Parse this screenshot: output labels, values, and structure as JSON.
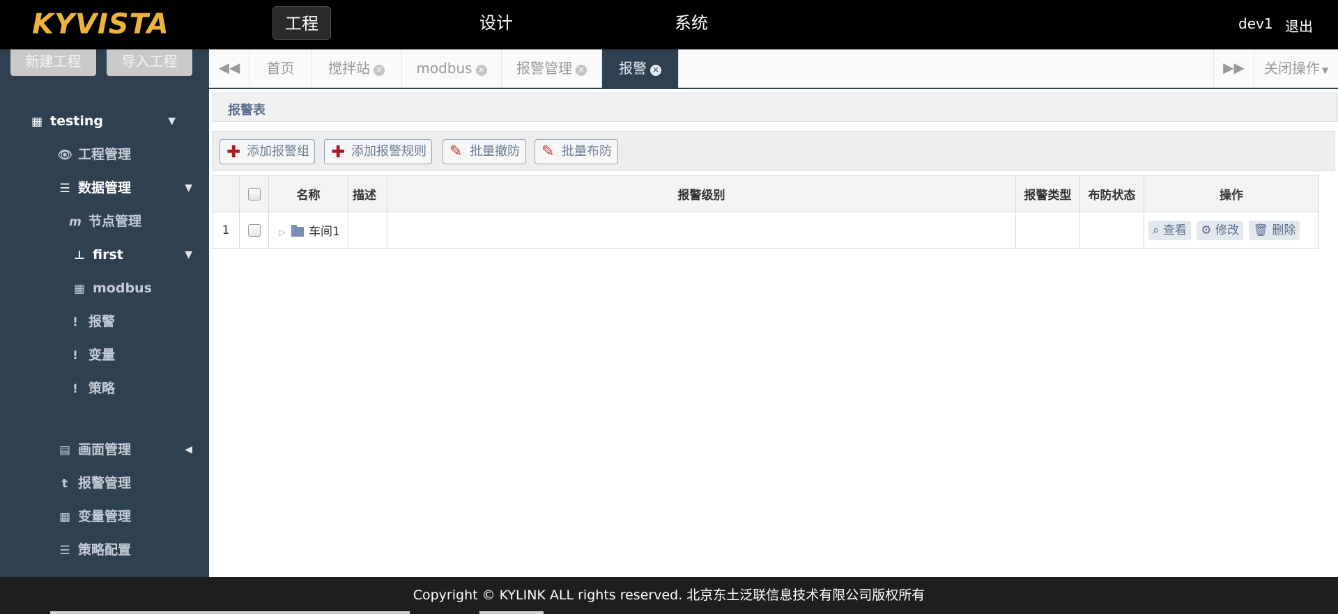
{
  "topbar": {
    "logo": "KYVISTA",
    "nav": {
      "project": "工程",
      "design": "设计",
      "system": "系统"
    },
    "user": "dev1",
    "logout": "退出"
  },
  "sidebar": {
    "buttons": {
      "new_project": "新建工程",
      "import_project": "导入工程"
    },
    "project_name": "testing",
    "items": {
      "project_mgmt": "工程管理",
      "data_mgmt": "数据管理",
      "node_mgmt": "节点管理",
      "first": "first",
      "modbus": "modbus",
      "alarm": "报警",
      "variable": "变量",
      "strategy": "策略",
      "screen_mgmt": "画面管理",
      "alarm_mgmt": "报警管理",
      "variable_mgmt": "变量管理",
      "strategy_config": "策略配置"
    }
  },
  "tabs": {
    "home": "首页",
    "mixer": "搅拌站",
    "modbus": "modbus",
    "alarm_mgmt": "报警管理",
    "alarm": "报警",
    "close_ops": "关闭操作"
  },
  "panel": {
    "title": "报警表",
    "toolbar": {
      "add_group": "添加报警组",
      "add_rule": "添加报警规则",
      "batch_disarm": "批量撤防",
      "batch_arm": "批量布防"
    },
    "table": {
      "headers": {
        "name": "名称",
        "desc": "描述",
        "level": "报警级别",
        "type": "报警类型",
        "arm_state": "布防状态",
        "ops": "操作"
      },
      "rows": [
        {
          "index": "1",
          "name": "车间1",
          "desc": "",
          "level": "",
          "type": "",
          "arm_state": ""
        }
      ],
      "actions": {
        "view": "查看",
        "edit": "修改",
        "delete": "删除"
      }
    }
  },
  "footer": {
    "copyright": "Copyright © KYLINK ALL rights reserved. 北京东土泛联信息技术有限公司版权所有"
  },
  "colors": {
    "sidebar_bg": "#2f4050",
    "logo": "#f0b33a",
    "accent_text": "#5a6d8c",
    "plus_icon": "#b0171f"
  }
}
